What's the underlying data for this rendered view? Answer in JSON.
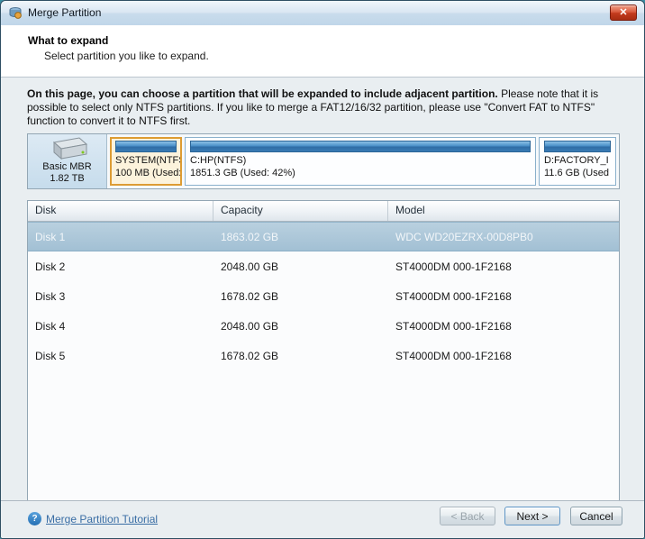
{
  "window": {
    "title": "Merge Partition"
  },
  "icons": {
    "close": "✕",
    "help": "?"
  },
  "header": {
    "title": "What to expand",
    "subtitle": "Select partition you like to expand."
  },
  "instructions": {
    "lead": "On this page, you can choose a partition that will be expanded to include adjacent partition.",
    "body": " Please note that it is possible to select only NTFS partitions. If you like to merge a FAT12/16/32 partition, please use \"Convert FAT to NTFS\" function to convert it to NTFS first."
  },
  "disk_map": {
    "disk": {
      "type": "Basic MBR",
      "size": "1.82 TB"
    },
    "partitions": [
      {
        "name": "SYSTEM(NTFS)",
        "detail": "100 MB (Used:",
        "selected": true
      },
      {
        "name": "C:HP(NTFS)",
        "detail": "1851.3 GB (Used: 42%)",
        "selected": false
      },
      {
        "name": "D:FACTORY_I",
        "detail": "11.6 GB (Used",
        "selected": false
      }
    ]
  },
  "table": {
    "columns": [
      "Disk",
      "Capacity",
      "Model"
    ],
    "rows": [
      {
        "disk": "Disk 1",
        "capacity": "1863.02 GB",
        "model": "WDC WD20EZRX-00D8PB0",
        "selected": true
      },
      {
        "disk": "Disk 2",
        "capacity": "2048.00 GB",
        "model": "ST4000DM 000-1F2168",
        "selected": false
      },
      {
        "disk": "Disk 3",
        "capacity": "1678.02 GB",
        "model": "ST4000DM 000-1F2168",
        "selected": false
      },
      {
        "disk": "Disk 4",
        "capacity": "2048.00 GB",
        "model": "ST4000DM 000-1F2168",
        "selected": false
      },
      {
        "disk": "Disk 5",
        "capacity": "1678.02 GB",
        "model": "ST4000DM 000-1F2168",
        "selected": false
      }
    ]
  },
  "footer": {
    "tutorial_link": "Merge Partition Tutorial",
    "buttons": {
      "back": "< Back",
      "next": "Next >",
      "cancel": "Cancel"
    }
  },
  "colors": {
    "selection_row": "#a9c4d6",
    "partition_bar": "#3c7fb5",
    "selected_partition_border": "#dd9c33",
    "link": "#3a6ea5",
    "close_button": "#c23a1d"
  }
}
